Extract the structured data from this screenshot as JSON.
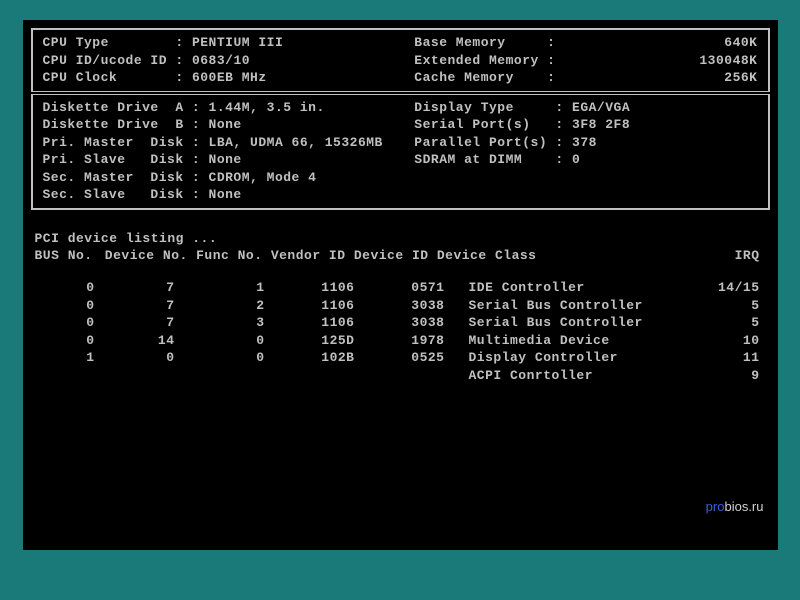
{
  "cpu": {
    "type_label": "CPU Type",
    "type_value": "PENTIUM III",
    "id_label": "CPU ID/ucode ID",
    "id_value": "0683/10",
    "clock_label": "CPU Clock",
    "clock_value": "600EB MHz"
  },
  "memory": {
    "base_label": "Base Memory",
    "base_value": "640K",
    "ext_label": "Extended Memory",
    "ext_value": "130048K",
    "cache_label": "Cache Memory",
    "cache_value": "256K"
  },
  "drives": {
    "fda_label": "Diskette Drive  A",
    "fda_value": "1.44M, 3.5 in.",
    "fdb_label": "Diskette Drive  B",
    "fdb_value": "None",
    "pm_label": "Pri. Master  Disk",
    "pm_value": "LBA, UDMA 66, 15326MB",
    "ps_label": "Pri. Slave   Disk",
    "ps_value": "None",
    "sm_label": "Sec. Master  Disk",
    "sm_value": "CDROM, Mode 4",
    "ss_label": "Sec. Slave   Disk",
    "ss_value": "None"
  },
  "ports": {
    "display_label": "Display Type",
    "display_value": "EGA/VGA",
    "serial_label": "Serial Port(s)",
    "serial_value": "3F8 2F8",
    "parallel_label": "Parallel Port(s)",
    "parallel_value": "378",
    "sdram_label": "SDRAM at DIMM",
    "sdram_value": "0"
  },
  "pci": {
    "title": "PCI device listing ...",
    "header_bus": "BUS No.",
    "header_rest": " Device No. Func No. Vendor ID Device ID Device Class",
    "header_irq": "IRQ",
    "rows": [
      {
        "bus": "0",
        "dev": "7",
        "func": "1",
        "vendor": "1106",
        "did": "0571",
        "class": "IDE Controller",
        "irq": "14/15"
      },
      {
        "bus": "0",
        "dev": "7",
        "func": "2",
        "vendor": "1106",
        "did": "3038",
        "class": "Serial Bus Controller",
        "irq": "5"
      },
      {
        "bus": "0",
        "dev": "7",
        "func": "3",
        "vendor": "1106",
        "did": "3038",
        "class": "Serial Bus Controller",
        "irq": "5"
      },
      {
        "bus": "0",
        "dev": "14",
        "func": "0",
        "vendor": "125D",
        "did": "1978",
        "class": "Multimedia Device",
        "irq": "10"
      },
      {
        "bus": "1",
        "dev": "0",
        "func": "0",
        "vendor": "102B",
        "did": "0525",
        "class": "Display Controller",
        "irq": "11"
      },
      {
        "bus": "",
        "dev": "",
        "func": "",
        "vendor": "",
        "did": "",
        "class": "ACPI Conrtoller",
        "irq": "9"
      }
    ]
  },
  "watermark": {
    "p1": "pro",
    "p2": "bios.ru"
  }
}
